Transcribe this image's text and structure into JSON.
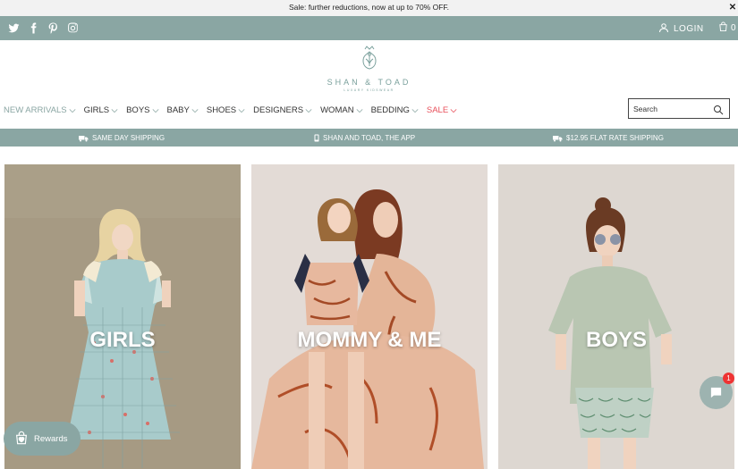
{
  "announcement": {
    "text": "Sale: further reductions, now at up to 70% OFF.",
    "close": "✕"
  },
  "topbar": {
    "login": "LOGIN",
    "cart_count": "0"
  },
  "brand": {
    "name": "SHAN & TOAD",
    "tagline": "LUXURY KIDSWEAR"
  },
  "nav": {
    "items": [
      {
        "label": "NEW ARRIVALS"
      },
      {
        "label": "GIRLS"
      },
      {
        "label": "BOYS"
      },
      {
        "label": "BABY"
      },
      {
        "label": "SHOES"
      },
      {
        "label": "DESIGNERS"
      },
      {
        "label": "WOMAN"
      },
      {
        "label": "BEDDING"
      },
      {
        "label": "SALE"
      }
    ]
  },
  "search": {
    "placeholder": "Search"
  },
  "promos": [
    {
      "label": "SAME DAY SHIPPING",
      "icon": "truck-icon"
    },
    {
      "label": "SHAN AND TOAD, THE APP",
      "icon": "phone-icon"
    },
    {
      "label": "$12.95 FLAT RATE SHIPPING",
      "icon": "truck-icon"
    }
  ],
  "tiles": [
    {
      "label": "GIRLS"
    },
    {
      "label": "MOMMY & ME"
    },
    {
      "label": "BOYS"
    }
  ],
  "rewards": {
    "label": "Rewards"
  },
  "chat": {
    "badge": "1"
  },
  "colors": {
    "sage": "#8aa6a3",
    "sale": "#e8505b",
    "announce_bg": "#f2f2f2"
  }
}
